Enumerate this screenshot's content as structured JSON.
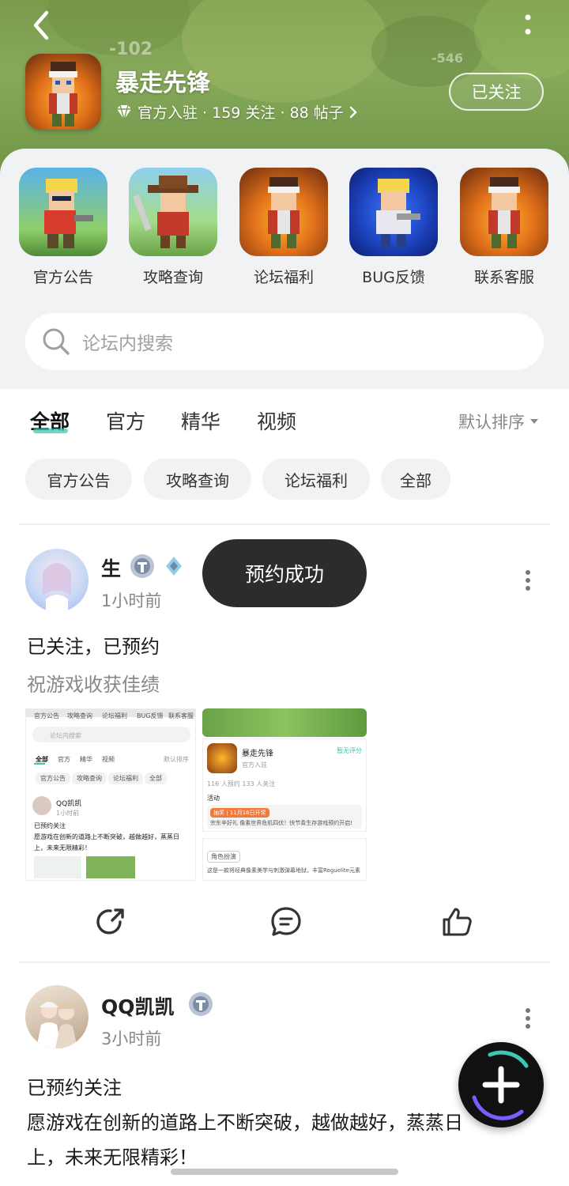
{
  "header": {
    "game_name": "暴走先锋",
    "meta": "官方入驻 · 159 关注 · 88 帖子",
    "follow_label": "已关注",
    "bg_numbers": [
      "-102",
      "-546"
    ]
  },
  "shortcuts": [
    {
      "label": "官方公告"
    },
    {
      "label": "攻略查询"
    },
    {
      "label": "论坛福利"
    },
    {
      "label": "BUG反馈"
    },
    {
      "label": "联系客服"
    }
  ],
  "search": {
    "placeholder": "论坛内搜索"
  },
  "tabs": [
    {
      "label": "全部",
      "active": true
    },
    {
      "label": "官方"
    },
    {
      "label": "精华"
    },
    {
      "label": "视频"
    }
  ],
  "sort": {
    "label": "默认排序"
  },
  "chips": [
    "官方公告",
    "攻略查询",
    "论坛福利",
    "全部"
  ],
  "toast": "预约成功",
  "posts": [
    {
      "user": "生",
      "time": "1小时前",
      "title": "已关注，已预约",
      "body": "祝游戏收获佳绩",
      "images": {
        "left": {
          "tabs": [
            "官方公告",
            "攻略查询",
            "论坛福利",
            "BUG反馈",
            "联系客服"
          ],
          "search": "论坛内搜索",
          "nav": [
            "全部",
            "官方",
            "精华",
            "视频"
          ],
          "sort": "默认排序",
          "chips": [
            "官方公告",
            "攻略查询",
            "论坛福利",
            "全部"
          ],
          "user": "QQ凯凯",
          "time": "1小时前",
          "line1": "已预约关注",
          "line2": "愿游戏在创新的道路上不断突破，越做越好，蒸蒸日",
          "line3": "上，未来无限精彩！"
        },
        "right": {
          "name": "暴走先锋",
          "tag": "官方入驻",
          "rate": "暂无评分",
          "stats": "116 人预约    133 人关注",
          "activity": "活动",
          "banner_tag": "抽奖 | 11月16日开奖",
          "banner_text": "宗东辛好礼 像素世界危机四伏！快节奏生存游戏预约开启!",
          "role": "角色扮演",
          "desc": "这是一款将经典像素美学与刺激弹幕地狱，丰富Roguelite元素"
        }
      }
    },
    {
      "user": "QQ凯凯",
      "time": "3小时前",
      "title": "已预约关注",
      "body1": "愿游戏在创新的道路上不断突破，越做越好，蒸蒸日",
      "body2": "上，未来无限精彩！"
    }
  ],
  "colors": {
    "accent": "#3cc8b4",
    "header_green": "#7a9a4c",
    "toast_bg": "#2c2c2c",
    "fab_bg": "#111111"
  }
}
